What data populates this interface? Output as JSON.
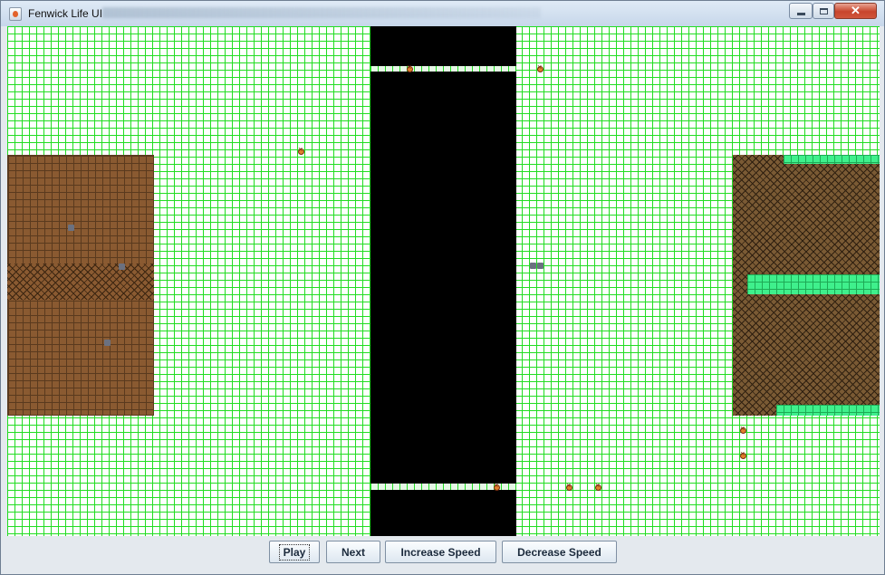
{
  "window": {
    "title": "Fenwick Life UI"
  },
  "titlebar_icons": [
    "app-icon",
    "minimize-icon",
    "maximize-icon",
    "close-icon"
  ],
  "controls": {
    "play_label": "Play",
    "next_label": "Next",
    "increase_label": "Increase Speed",
    "decrease_label": "Decrease Speed"
  },
  "simulation_grid": {
    "background": "#ffffff",
    "gridline_color": "#22dd22",
    "dirt_color": "#8a5a31",
    "field_color": "#3ff08c",
    "road_color": "#000000",
    "agent_color": "#e2822c",
    "rock_color": "#6b7180"
  }
}
